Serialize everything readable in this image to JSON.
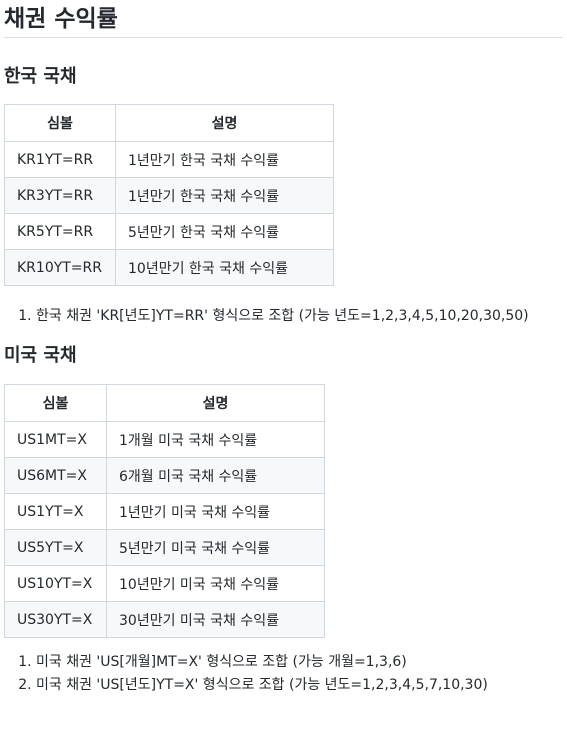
{
  "title": "채권 수익률",
  "korea": {
    "heading": "한국 국채",
    "headers": [
      "심볼",
      "설명"
    ],
    "rows": [
      [
        "KR1YT=RR",
        "1년만기 한국 국채 수익률"
      ],
      [
        "KR3YT=RR",
        "1년만기 한국 국채 수익률"
      ],
      [
        "KR5YT=RR",
        "5년만기 한국 국채 수익률"
      ],
      [
        "KR10YT=RR",
        "10년만기 한국 국채 수익률"
      ]
    ],
    "notes": [
      "한국 채권 'KR[년도]YT=RR' 형식으로 조합 (가능 년도=1,2,3,4,5,10,20,30,50)"
    ]
  },
  "us": {
    "heading": "미국 국채",
    "headers": [
      "심볼",
      "설명"
    ],
    "rows": [
      [
        "US1MT=X",
        "1개월 미국 국채 수익률"
      ],
      [
        "US6MT=X",
        "6개월 미국 국채 수익률"
      ],
      [
        "US1YT=X",
        "1년만기 미국 국채 수익률"
      ],
      [
        "US5YT=X",
        "5년만기 미국 국채 수익률"
      ],
      [
        "US10YT=X",
        "10년만기 미국 국채 수익률"
      ],
      [
        "US30YT=X",
        "30년만기 미국 국채 수익률"
      ]
    ],
    "notes": [
      "미국 채권 'US[개월]MT=X' 형식으로 조합 (가능 개월=1,3,6)",
      "미국 채권 'US[년도]YT=X' 형식으로 조합 (가능 년도=1,2,3,4,5,7,10,30)"
    ]
  }
}
